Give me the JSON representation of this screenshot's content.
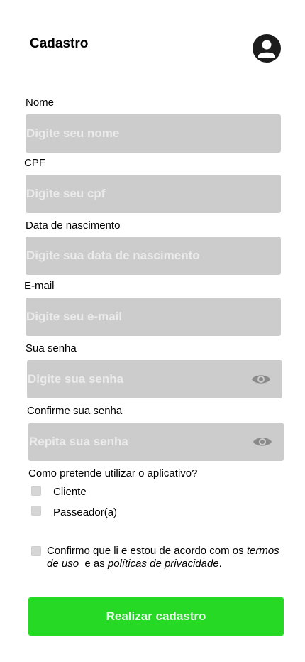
{
  "header": {
    "title": "Cadastro"
  },
  "fields": {
    "nome": {
      "label": "Nome",
      "placeholder": "Digite seu nome",
      "value": ""
    },
    "cpf": {
      "label": "CPF",
      "placeholder": "Digite seu cpf",
      "value": ""
    },
    "nascimento": {
      "label": "Data de nascimento",
      "placeholder": "Digite sua data de nascimento",
      "value": ""
    },
    "email": {
      "label": "E-mail",
      "placeholder": "Digite seu e-mail",
      "value": ""
    },
    "senha": {
      "label": "Sua senha",
      "placeholder": "Digite sua senha",
      "value": ""
    },
    "confirmar": {
      "label": "Confirme sua senha",
      "placeholder": "Repita sua senha",
      "value": ""
    }
  },
  "usage": {
    "question": "Como pretende utilizar o aplicativo?",
    "options": [
      {
        "label": "Cliente",
        "checked": false
      },
      {
        "label": "Passeador(a)",
        "checked": false
      }
    ]
  },
  "terms": {
    "text_before": "Confirmo que li e estou de acordo com os ",
    "terms_link": "termos de uso",
    "text_middle": "  e as ",
    "privacy_link": "políticas de privacidade",
    "text_after": ".",
    "checked": false
  },
  "submit": {
    "label": "Realizar cadastro"
  },
  "colors": {
    "field_bg": "#cccccc",
    "placeholder": "#ebebeb",
    "submit_bg": "#25d925",
    "avatar": "#1c1c1c",
    "eye_icon": "#8a8a8a"
  },
  "icons": {
    "avatar": "user-circle-icon",
    "eye": "eye-icon"
  }
}
